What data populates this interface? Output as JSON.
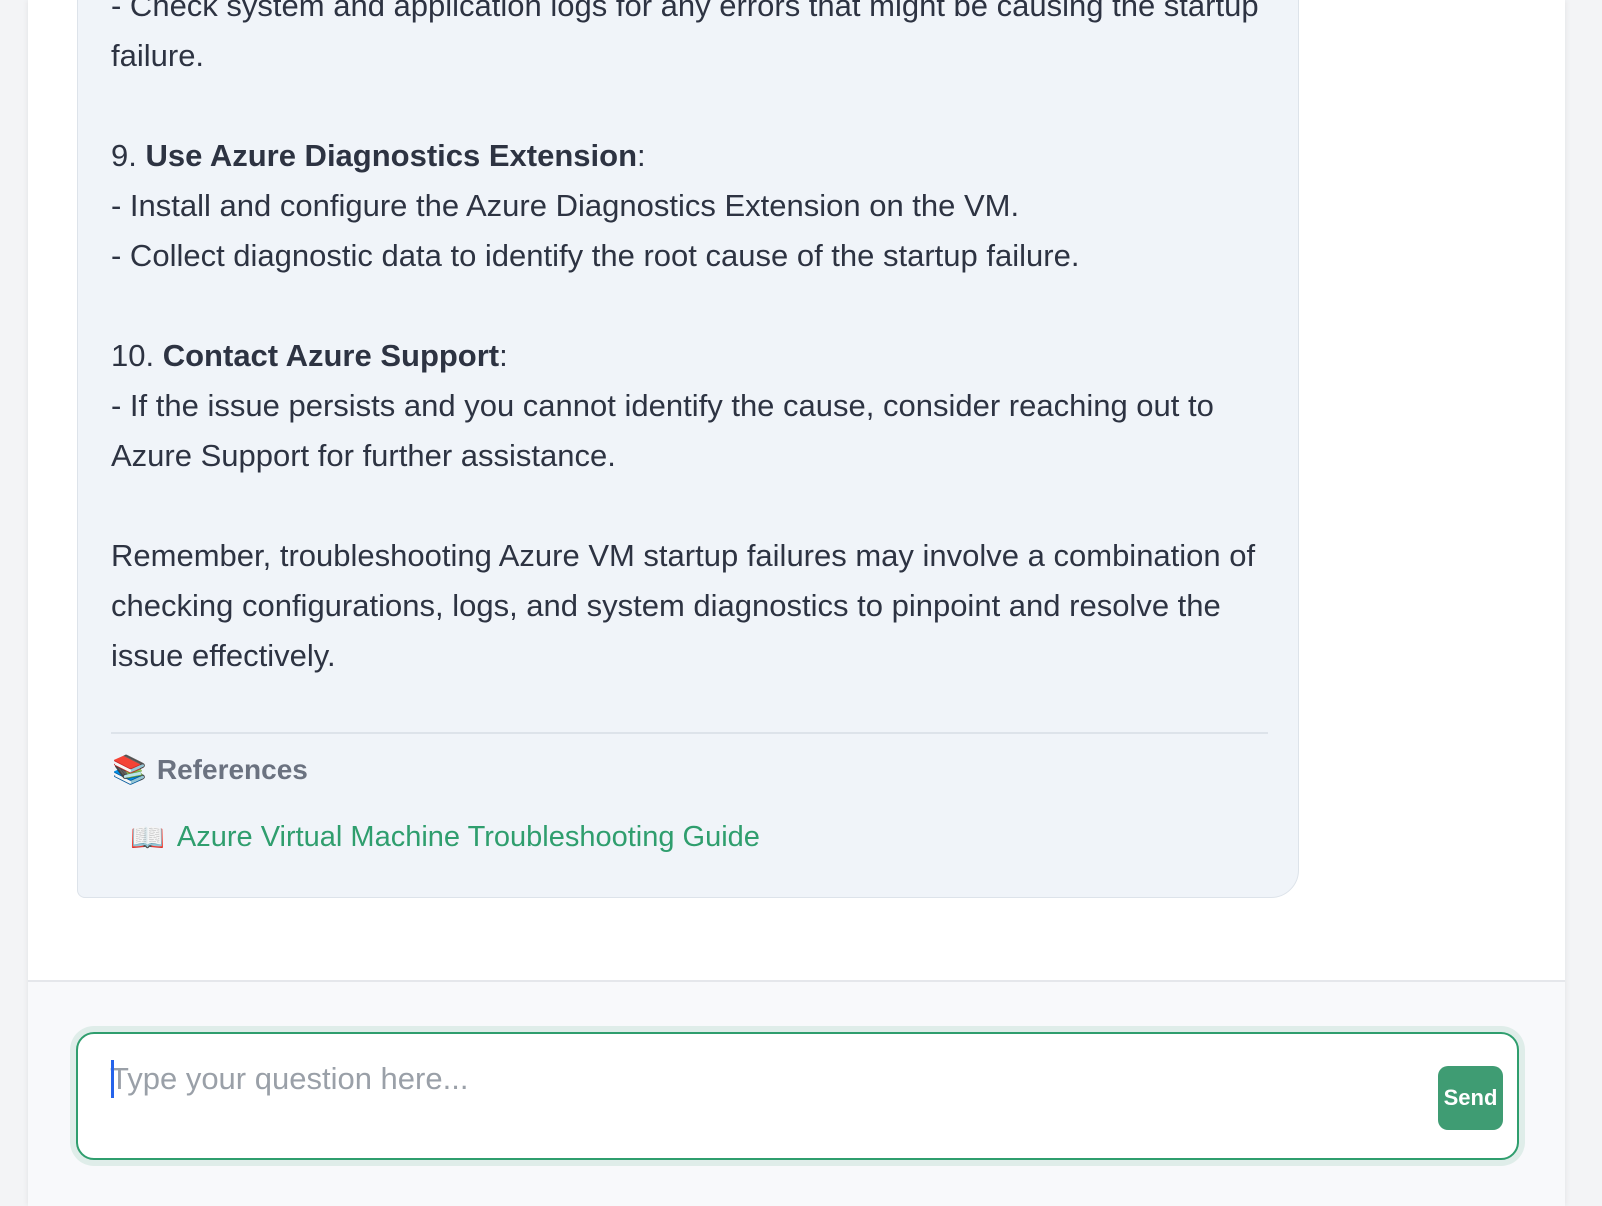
{
  "message": {
    "paragraphs": [
      {
        "kind": "text",
        "lines": [
          "- Check system and application logs for any errors that might be causing the startup failure."
        ]
      },
      {
        "kind": "gap"
      },
      {
        "kind": "step",
        "number": "9.",
        "title": "Use Azure Diagnostics Extension",
        "suffix": ":"
      },
      {
        "kind": "text",
        "lines": [
          "- Install and configure the Azure Diagnostics Extension on the VM."
        ]
      },
      {
        "kind": "text",
        "lines": [
          "- Collect diagnostic data to identify the root cause of the startup failure."
        ]
      },
      {
        "kind": "gap"
      },
      {
        "kind": "step",
        "number": "10.",
        "title": "Contact Azure Support",
        "suffix": ":"
      },
      {
        "kind": "text",
        "lines": [
          "- If the issue persists and you cannot identify the cause, consider reaching out to Azure Support for further assistance."
        ]
      },
      {
        "kind": "gap"
      },
      {
        "kind": "text",
        "lines": [
          "Remember, troubleshooting Azure VM startup failures may involve a combination of checking configurations, logs, and system diagnostics to pinpoint and resolve the issue effectively."
        ]
      }
    ]
  },
  "references": {
    "heading_icon": "📚",
    "heading": "References",
    "items": [
      {
        "icon": "📖",
        "label": "Azure Virtual Machine Troubleshooting Guide"
      }
    ]
  },
  "composer": {
    "placeholder": "Type your question here...",
    "value": "",
    "send_label": "Send"
  },
  "colors": {
    "accent": "#2f9e6e",
    "send_button": "#3f9c73",
    "bubble_bg": "#f0f4f9",
    "text": "#2d3342"
  }
}
